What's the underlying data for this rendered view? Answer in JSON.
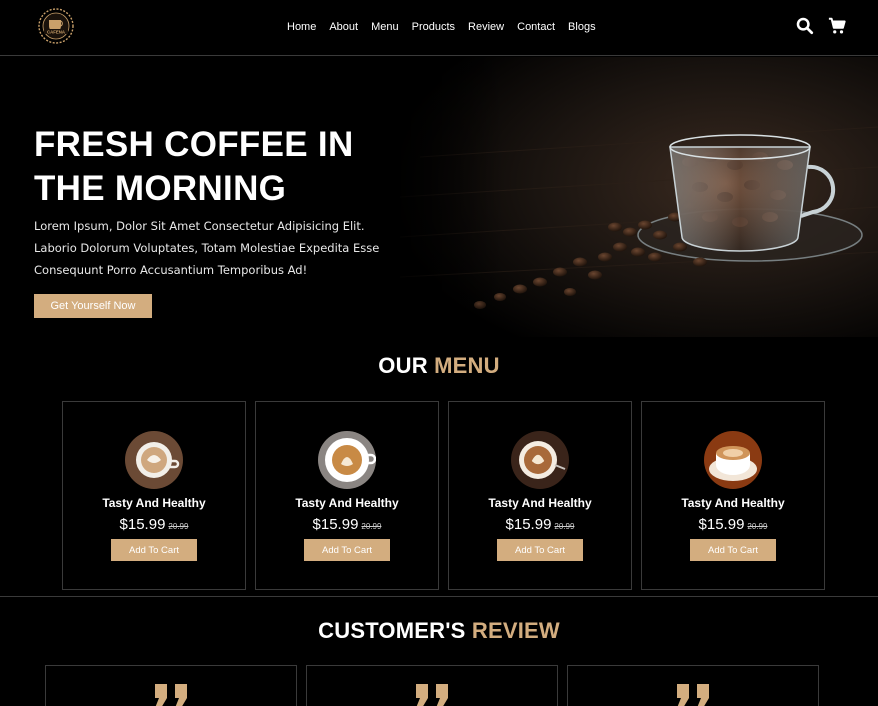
{
  "header": {
    "logo_text": "CAFENA",
    "logo_icon": "coffee-cup-logo",
    "nav": [
      "Home",
      "About",
      "Menu",
      "Products",
      "Review",
      "Contact",
      "Blogs"
    ],
    "icons": [
      "search-icon",
      "cart-icon"
    ]
  },
  "hero": {
    "title": "FRESH COFFEE IN THE MORNING",
    "text": "Lorem Ipsum, Dolor Sit Amet Consectetur Adipisicing Elit. Laborio Dolorum Voluptates, Totam Molestiae Expedita Esse Consequunt Porro Accusantium Temporibus Ad!",
    "button": "Get Yourself Now",
    "image_icon": "coffee-beans-cup-image"
  },
  "menu": {
    "title_main": "OUR ",
    "title_accent": "MENU",
    "items": [
      {
        "name": "Tasty And Healthy",
        "price": "$15.99",
        "old_price": "20.99",
        "button": "Add To Cart"
      },
      {
        "name": "Tasty And Healthy",
        "price": "$15.99",
        "old_price": "20.99",
        "button": "Add To Cart"
      },
      {
        "name": "Tasty And Healthy",
        "price": "$15.99",
        "old_price": "20.99",
        "button": "Add To Cart"
      },
      {
        "name": "Tasty And Healthy",
        "price": "$15.99",
        "old_price": "20.99",
        "button": "Add To Cart"
      }
    ]
  },
  "review": {
    "title_main": "CUSTOMER'S ",
    "title_accent": "REVIEW",
    "quote_icon": "quote-icon"
  },
  "colors": {
    "accent": "#d3ad7f",
    "background": "#000000",
    "border": "#3a3a3a"
  }
}
